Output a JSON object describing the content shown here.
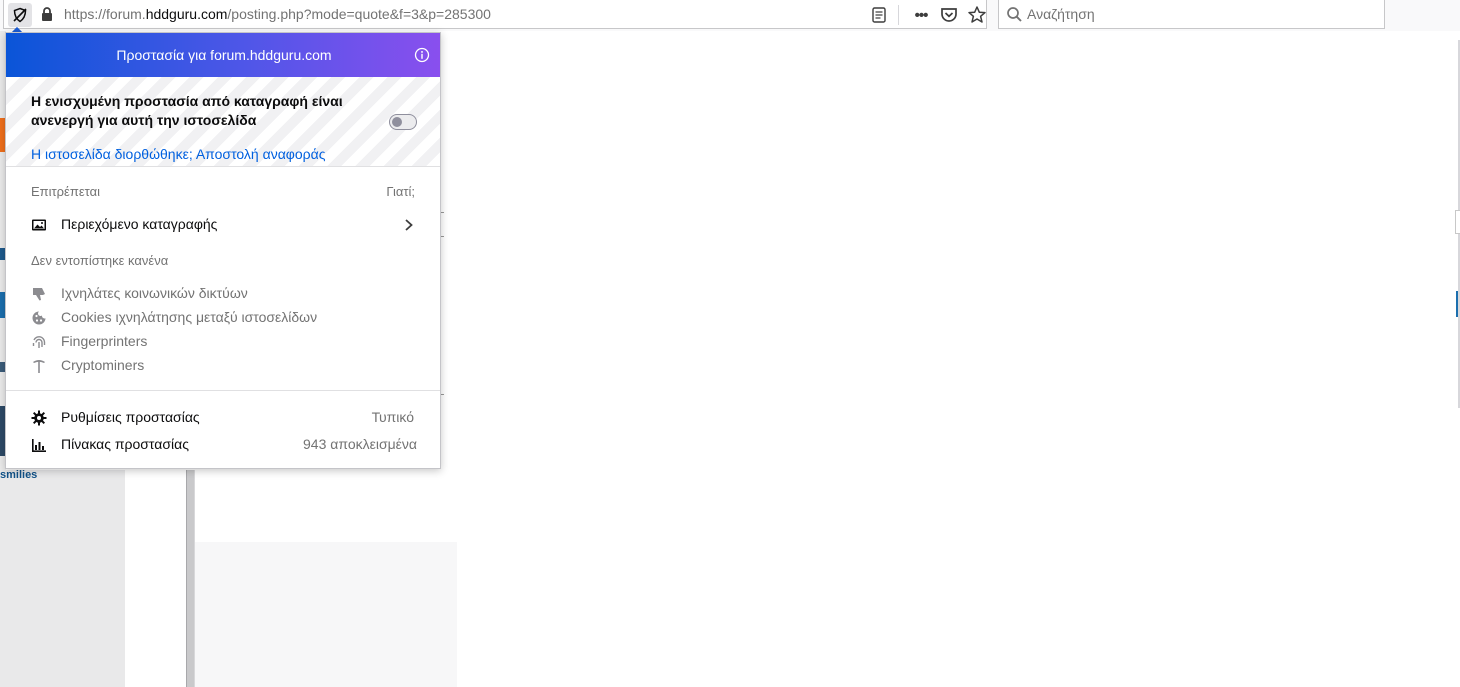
{
  "toolbar": {
    "url_prefix": "https://forum.",
    "url_host": "hddguru.com",
    "url_path": "/posting.php?mode=quote&f=3&p=285300",
    "search_placeholder": "Αναζήτηση"
  },
  "page": {
    "smilies_fragment": "smilies"
  },
  "panel": {
    "title": "Προστασία για forum.hddguru.com",
    "etp_status": "Η ενισχυμένη προστασία από καταγραφή είναι ανενεργή για αυτή την ιστοσελίδα",
    "etp_enabled": false,
    "site_fixed": "Η ιστοσελίδα διορθώθηκε;",
    "send_report": "Αποστολή αναφοράς",
    "allowed_label": "Επιτρέπεται",
    "why_label": "Γιατί;",
    "allowed_items": [
      {
        "icon": "image-icon",
        "label": "Περιεχόμενο καταγραφής"
      }
    ],
    "none_detected_label": "Δεν εντοπίστηκε κανένα",
    "none_detected_items": [
      {
        "icon": "thumbs-down-icon",
        "label": "Ιχνηλάτες κοινωνικών δικτύων"
      },
      {
        "icon": "cookie-icon",
        "label": "Cookies ιχνηλάτησης μεταξύ ιστοσελίδων"
      },
      {
        "icon": "fingerprint-icon",
        "label": "Fingerprinters"
      },
      {
        "icon": "pickaxe-icon",
        "label": "Cryptominers"
      }
    ],
    "settings_label": "Ρυθμίσεις προστασίας",
    "settings_value": "Τυπικό",
    "dashboard_label": "Πίνακας προστασίας",
    "dashboard_value": "943 αποκλεισμένα"
  },
  "colors": {
    "header_gradient_start": "#0a55d8",
    "header_gradient_end": "#8a4fee",
    "link": "#0060df",
    "muted_text": "#737373"
  }
}
